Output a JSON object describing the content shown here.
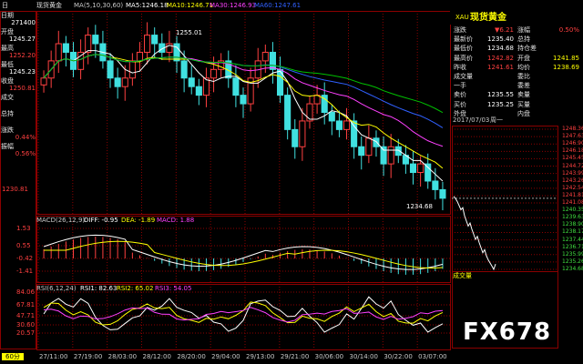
{
  "topbar": {
    "title": "现货黄金",
    "ma_params": "MA(5,10,30,60)",
    "ma5": "MA5:1246.18",
    "ma10": "MA10:1246.71",
    "ma30": "MA30:1246.93",
    "ma60": "MA60:1247.61",
    "corner_label": "日"
  },
  "leftcol": {
    "items": [
      {
        "label": "日期",
        "value": "271400"
      },
      {
        "label": "开盘",
        "value": "1245.27"
      },
      {
        "label": "最高",
        "value": "1252.20"
      },
      {
        "label": "最低",
        "value": "1245.23"
      },
      {
        "label": "收盘",
        "value": "1250.81"
      },
      {
        "label": "成交",
        "value": ""
      },
      {
        "label": "总持",
        "value": ""
      },
      {
        "label": "涨跌",
        "value": "0.44%"
      },
      {
        "label": "振幅",
        "value": "0.56%"
      }
    ]
  },
  "price_axis": [
    "1230.81"
  ],
  "annotations": {
    "high": "1255.01",
    "low": "1234.68"
  },
  "macd": {
    "header": "MACD(26,12,9)",
    "diff": "DIFF: -0.95",
    "dea": "DEA: -1.89",
    "macd": "MACD: 1.88",
    "levels": [
      "1.53",
      "0.55",
      "-0.42",
      "-1.41"
    ]
  },
  "rsi": {
    "header": "RSI(6,12,24)",
    "rsi1": "RSI1: 82.63",
    "rsi2": "RSI2: 65.02",
    "rsi3": "RSI3: 54.05",
    "levels": [
      "84.06",
      "67.81",
      "47.71",
      "30.60",
      "20.57"
    ]
  },
  "period": "60分",
  "time_axis": [
    "27/11:00",
    "27/19:00",
    "28/03:00",
    "28/12:00",
    "28/20:00",
    "29/04:00",
    "29/13:00",
    "29/21:00",
    "30/06:00",
    "30/14:00",
    "30/22:00",
    "03/07:00"
  ],
  "rightpanel": {
    "code": "XAU",
    "name": "现货黄金",
    "rows": [
      {
        "l1": "涨跌",
        "v1": "▼6.21",
        "l2": "涨幅",
        "v2": "0.50%"
      },
      {
        "l1": "最新价",
        "v1": "1235.40",
        "l2": "总持",
        "v2": ""
      },
      {
        "l1": "最低价",
        "v1": "1234.68",
        "l2": "持仓差",
        "v2": ""
      },
      {
        "l1": "最高价",
        "v1": "1242.82",
        "l2": "开盘",
        "v2": "1241.85"
      },
      {
        "l1": "昨收",
        "v1": "1241.61",
        "l2": "均价",
        "v2": "1238.69"
      },
      {
        "l1": "成交量",
        "v1": "",
        "l2": "委比",
        "v2": ""
      },
      {
        "l1": "一手",
        "v1": "",
        "l2": "委差",
        "v2": ""
      },
      {
        "l1": "卖价",
        "v1": "1235.55",
        "l2": "卖量",
        "v2": ""
      },
      {
        "l1": "买价",
        "v1": "1235.25",
        "l2": "买量",
        "v2": ""
      },
      {
        "l1": "外盘",
        "v1": "",
        "l2": "内盘",
        "v2": ""
      }
    ],
    "intraday_date": "2017/07/03",
    "intraday_day": "周一",
    "intraday_levels": [
      "1248.36",
      "1247.63",
      "1246.90",
      "1246.18",
      "1245.45",
      "1244.72",
      "1243.99",
      "1243.26",
      "1242.54",
      "1241.81",
      "1241.08",
      "1240.35",
      "1239.63",
      "1238.90",
      "1238.17",
      "1237.44",
      "1236.71",
      "1235.99",
      "1235.26",
      "1234.68"
    ],
    "volume_label": "成交量"
  },
  "watermark": "FX678",
  "colors": {
    "up": "#ff4040",
    "down": "#40e0e0",
    "ma5": "#ffffff",
    "ma10": "#ffff00",
    "ma30": "#ff40ff",
    "ma60": "#00c000",
    "grid": "#8b0000",
    "highlight": "#ffff00"
  },
  "chart_data": {
    "type": "candlestick",
    "title": "现货黄金",
    "ylim": [
      1230.81,
      1255.01
    ],
    "close_series_approx": [
      1249,
      1251,
      1253,
      1252,
      1250,
      1252,
      1254,
      1253,
      1251,
      1249,
      1248,
      1249,
      1251,
      1252,
      1254,
      1253,
      1252,
      1253,
      1251,
      1249,
      1248,
      1247,
      1249,
      1250,
      1251,
      1249,
      1247,
      1246,
      1249,
      1251,
      1252,
      1250,
      1247,
      1243,
      1241,
      1244,
      1246,
      1247,
      1245,
      1244,
      1243,
      1244,
      1241,
      1240,
      1242,
      1241,
      1239,
      1241,
      1240,
      1239,
      1238,
      1239,
      1237,
      1236,
      1235
    ]
  }
}
